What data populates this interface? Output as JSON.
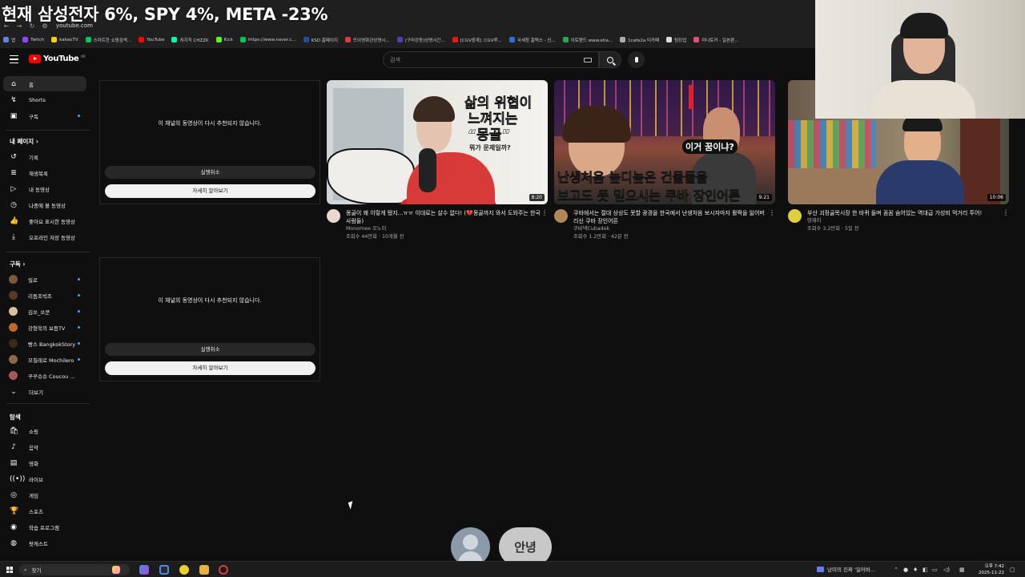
{
  "overlay_title": "현재 삼성전자 6%, SPY 4%, META -23%",
  "browser": {
    "url": "youtube.com",
    "bookmarks": [
      {
        "label": "앱",
        "color": "#5f86d3"
      },
      {
        "label": "Twitch",
        "color": "#9146ff"
      },
      {
        "label": "kakaoTV",
        "color": "#ffcd00"
      },
      {
        "label": "스마트한 쇼핑검색...",
        "color": "#03c75a"
      },
      {
        "label": "YouTube",
        "color": "#ff0000"
      },
      {
        "label": "치지직 CHZZK",
        "color": "#00ffa3"
      },
      {
        "label": "Kick",
        "color": "#53fc18"
      },
      {
        "label": "https://www.naver.c...",
        "color": "#03c75a"
      },
      {
        "label": "KSD 홈페이지",
        "color": "#1d4ea1"
      },
      {
        "label": "뜨이영화관상영시...",
        "color": "#e03a3a"
      },
      {
        "label": "(구미강동)상영시간...",
        "color": "#4b3fc0"
      },
      {
        "label": "[CGV중계] :CGV루...",
        "color": "#e71a0f"
      },
      {
        "label": "국세청 홈택스 - 신...",
        "color": "#2d6fd6"
      },
      {
        "label": "이토랜드 www.etla...",
        "color": "#29a847"
      },
      {
        "label": "1cafe2a 티카페",
        "color": "#aaaaaa"
      },
      {
        "label": "팀킹업",
        "color": "#dddddd"
      },
      {
        "label": "마나토카 - 일본판...",
        "color": "#e0507a"
      }
    ]
  },
  "youtube": {
    "logo": "YouTube",
    "logo_region": "KR",
    "search_placeholder": "검색",
    "sidebar": {
      "main": [
        {
          "label": "홈",
          "icon": "⌂"
        },
        {
          "label": "Shorts",
          "icon": "↯"
        },
        {
          "label": "구독",
          "icon": "▣"
        }
      ],
      "you_header": "내 페이지  ›",
      "you": [
        {
          "label": "기록",
          "icon": "↺"
        },
        {
          "label": "재생목록",
          "icon": "≣"
        },
        {
          "label": "내 동영상",
          "icon": "▷"
        },
        {
          "label": "나중에 볼 동영상",
          "icon": "◷"
        },
        {
          "label": "좋아요 표시한 동영상",
          "icon": "👍"
        },
        {
          "label": "오프라인 저장 동영상",
          "icon": "⤓"
        }
      ],
      "subs_header": "구독  ›",
      "subscriptions": [
        {
          "label": "릴로",
          "color": "#7a5a3a"
        },
        {
          "label": "리듬조빅조",
          "color": "#553a2a"
        },
        {
          "label": "김쏘_쏘쿤",
          "color": "#d9c0a0"
        },
        {
          "label": "강형욱의 보듬TV",
          "color": "#c0682a"
        },
        {
          "label": "빵스 BangkokStory",
          "color": "#3a2a1a"
        },
        {
          "label": "모칠레로 Mochilero",
          "color": "#8a6a4a"
        },
        {
          "label": "꾸꾸슈슈 Coucou ...",
          "color": "#a05a5a"
        }
      ],
      "more": "더보기",
      "explore_header": "탐색",
      "explore": [
        {
          "label": "쇼핑",
          "icon": "🛍"
        },
        {
          "label": "음악",
          "icon": "♪"
        },
        {
          "label": "영화",
          "icon": "▤"
        },
        {
          "label": "라이브",
          "icon": "((•))"
        },
        {
          "label": "게임",
          "icon": "◎"
        },
        {
          "label": "스포츠",
          "icon": "🏆"
        },
        {
          "label": "학습 프로그램",
          "icon": "◉"
        },
        {
          "label": "팟캐스트",
          "icon": "◍"
        }
      ]
    },
    "hidden_cards": [
      {
        "message": "이 채널의 동영상이 다시 추천되지 않습니다.",
        "undo": "실행취소",
        "learn": "자세히 알아보기"
      },
      {
        "message": "이 채널의 동영상이 다시 추천되지 않습니다.",
        "undo": "실행취소",
        "learn": "자세히 알아보기"
      }
    ],
    "videos": [
      {
        "title": "몽골이 왜 이렇게 됐지...ㅠㅠ 이대로는 살수 없다! (💔몽골까지 와서 도와주는 한국 사람들)",
        "channel": "Monomee 모노미",
        "stats": "조회수 44만회 · 10개월 전",
        "duration": "8:20",
        "thumb_text1": "삶의 위협이",
        "thumb_text2": "느껴지는",
        "thumb_text3": "“몽골”",
        "thumb_text4": "뭐가 문제일까?",
        "avatar_color": "#e8d8d0"
      },
      {
        "title": "쿠바에서는 절대 상상도 못할 광경을 한국에서 난생처음 보시자마자 활짝을 잃어버리신 쿠바 장인어른",
        "channel": "쿠바댁Cubadek",
        "stats": "조회수 1.2만회 · 42분 전",
        "duration": "9:21",
        "thumb_text1": "난생처음 높디높은 건물들을",
        "thumb_text2": "보고도 못 믿으시는 쿠바 장인어른",
        "thumb_text3": "이거 꿈이냐?",
        "avatar_color": "#b08858"
      },
      {
        "title": "부산 괴정골목시장 한 바퀴 돌며 꼼꼼 숨어있는 역대급 가성비 먹거리 투어!",
        "channel": "텐제이",
        "stats": "조회수 3.2만회 · 5일 전",
        "duration": "10:06",
        "avatar_color": "#e0d040"
      }
    ]
  },
  "float_bubble": "안녕",
  "taskbar": {
    "search": "찾기",
    "media": "남미의 진짜 '잃어버...",
    "time": "오후 7:42",
    "date": "2025-11-22"
  }
}
